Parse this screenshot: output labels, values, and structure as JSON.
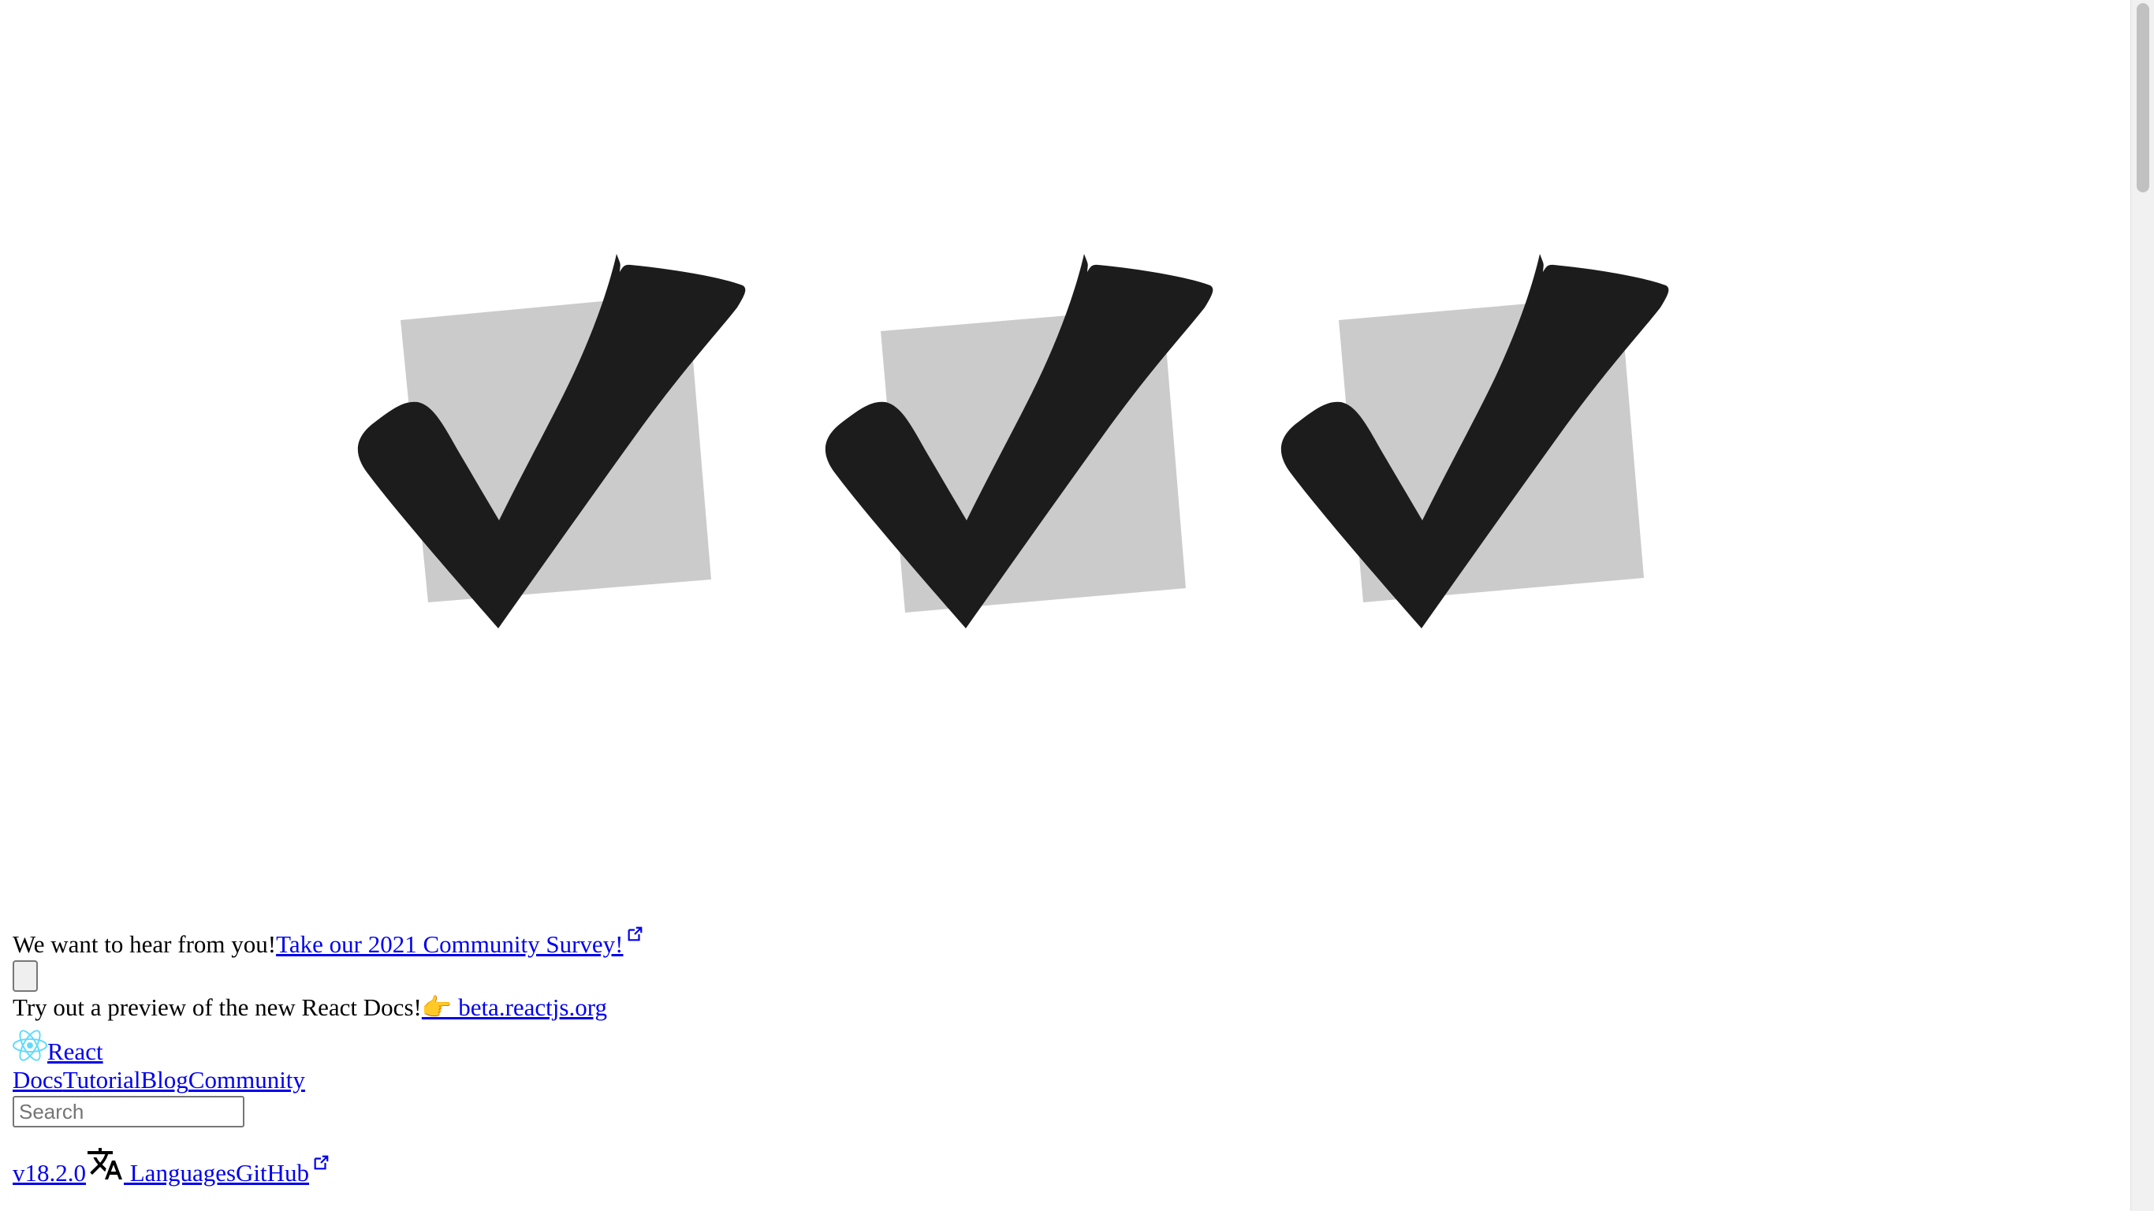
{
  "banner": {
    "message": "We want to hear from you!",
    "survey_link": "Take our 2021 Community Survey!"
  },
  "beta": {
    "message": "Try out a preview of the new React Docs!",
    "emoji": "👉",
    "link": " beta.reactjs.org"
  },
  "nav": {
    "brand": "React",
    "links": [
      "Docs",
      "Tutorial",
      "Blog",
      "Community"
    ],
    "search_placeholder": "Search",
    "version": "v18.2.0",
    "languages": " Languages",
    "github": "GitHub"
  },
  "icons": {
    "hero": "check-mark-icon",
    "external": "external-link-icon",
    "logo": "react-logo-icon",
    "translate": "translate-icon"
  },
  "colors": {
    "link": "#0000ee",
    "check": "#1c1c1c",
    "check_box": "#cbcbcb",
    "react_logo": "#61dafb"
  }
}
